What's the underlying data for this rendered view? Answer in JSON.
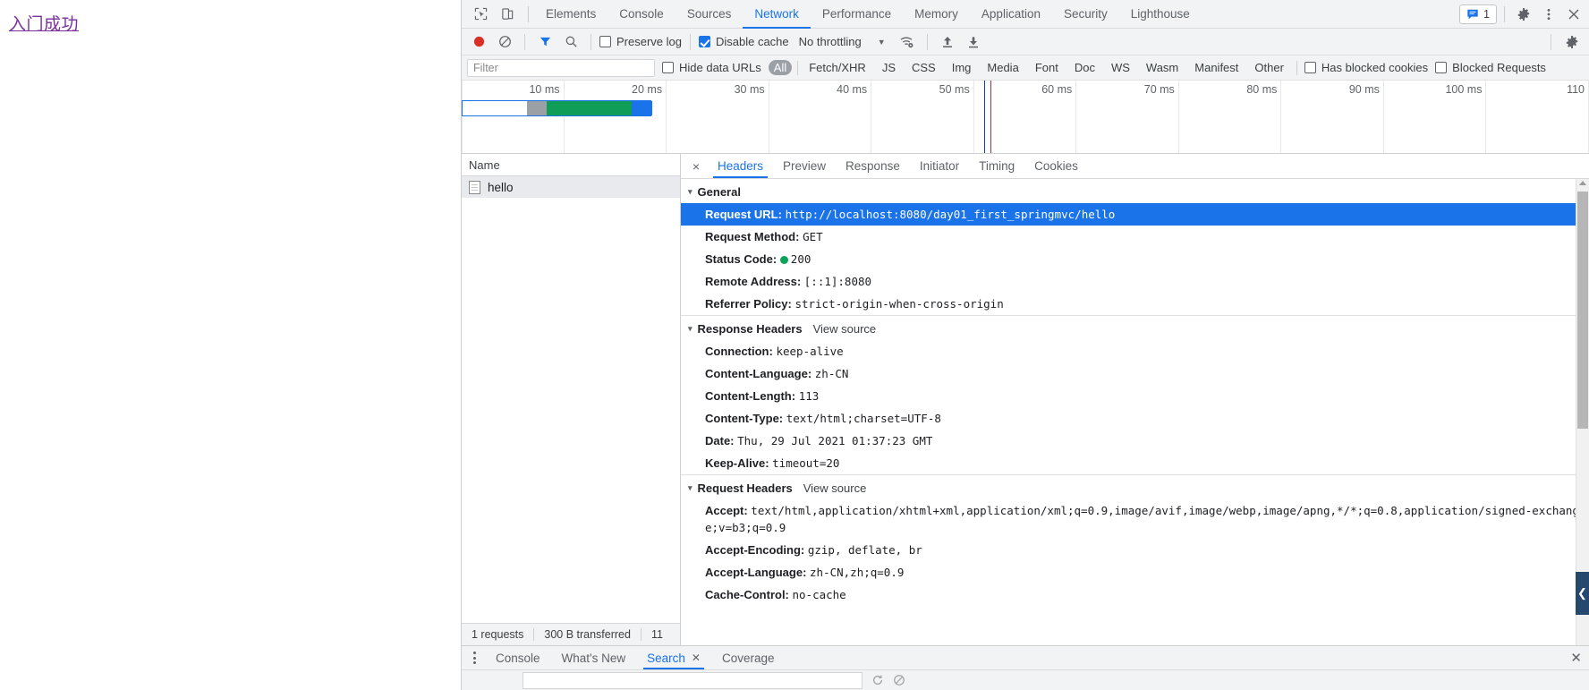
{
  "page": {
    "link_text": "入门成功"
  },
  "main_tabbar": {
    "icons": [
      {
        "name": "inspect-element-icon",
        "label": "Inspect element"
      },
      {
        "name": "device-toolbar-icon",
        "label": "Toggle device toolbar"
      }
    ],
    "tabs": [
      {
        "label": "Elements",
        "active": false
      },
      {
        "label": "Console",
        "active": false
      },
      {
        "label": "Sources",
        "active": false
      },
      {
        "label": "Network",
        "active": true
      },
      {
        "label": "Performance",
        "active": false
      },
      {
        "label": "Memory",
        "active": false
      },
      {
        "label": "Application",
        "active": false
      },
      {
        "label": "Security",
        "active": false
      },
      {
        "label": "Lighthouse",
        "active": false
      }
    ],
    "message_count": "1",
    "right_icons": [
      {
        "name": "message-badge-icon"
      },
      {
        "name": "settings-gear-icon"
      },
      {
        "name": "more-options-icon"
      },
      {
        "name": "close-devtools-icon"
      }
    ]
  },
  "network_toolbar": {
    "record_label": "Record network log",
    "clear_label": "Clear",
    "filter_icon_label": "Filter",
    "search_icon_label": "Search",
    "preserve_log": {
      "label": "Preserve log",
      "checked": false
    },
    "disable_cache": {
      "label": "Disable cache",
      "checked": true
    },
    "throttling": {
      "value": "No throttling",
      "caret": "▼"
    },
    "wifi_icon_label": "Network conditions",
    "import_label": "Import HAR file",
    "export_label": "Export HAR file",
    "settings_label": "Network settings"
  },
  "filter_row": {
    "filter_placeholder": "Filter",
    "filter_value": "",
    "hide_data_urls": {
      "label": "Hide data URLs",
      "checked": false
    },
    "types": [
      {
        "label": "All",
        "active": true
      },
      {
        "label": "Fetch/XHR",
        "active": false
      },
      {
        "label": "JS",
        "active": false
      },
      {
        "label": "CSS",
        "active": false
      },
      {
        "label": "Img",
        "active": false
      },
      {
        "label": "Media",
        "active": false
      },
      {
        "label": "Font",
        "active": false
      },
      {
        "label": "Doc",
        "active": false
      },
      {
        "label": "WS",
        "active": false
      },
      {
        "label": "Wasm",
        "active": false
      },
      {
        "label": "Manifest",
        "active": false
      },
      {
        "label": "Other",
        "active": false
      }
    ],
    "has_blocked_cookies": {
      "label": "Has blocked cookies",
      "checked": false
    },
    "blocked_requests": {
      "label": "Blocked Requests",
      "checked": false
    }
  },
  "overview": {
    "ticks": [
      "10 ms",
      "20 ms",
      "30 ms",
      "40 ms",
      "50 ms",
      "60 ms",
      "70 ms",
      "80 ms",
      "90 ms",
      "100 ms",
      "110"
    ],
    "bar": {
      "total_ms": 18.5,
      "segments": [
        {
          "name": "waiting",
          "start_ms": 0.0,
          "end_ms": 6.3,
          "color": "#ffffff"
        },
        {
          "name": "stalled",
          "start_ms": 6.3,
          "end_ms": 8.2,
          "color": "#9aa0a6"
        },
        {
          "name": "download",
          "start_ms": 8.2,
          "end_ms": 16.5,
          "color": "#0f9d58"
        },
        {
          "name": "finish",
          "start_ms": 16.5,
          "end_ms": 18.5,
          "color": "#1a73e8"
        }
      ]
    },
    "event_lines": [
      {
        "name": "dom-content-loaded",
        "ms": 51.0,
        "color": "#0d47a1"
      },
      {
        "name": "load",
        "ms": 51.6,
        "color": "#c62828"
      }
    ]
  },
  "requests_pane": {
    "column_header": "Name",
    "rows": [
      {
        "name": "hello",
        "selected": true,
        "icon": "document-icon"
      }
    ],
    "status": {
      "requests": "1 requests",
      "transferred": "300 B transferred",
      "resources": "11"
    }
  },
  "detail": {
    "tabs": [
      {
        "label": "Headers",
        "active": true
      },
      {
        "label": "Preview",
        "active": false
      },
      {
        "label": "Response",
        "active": false
      },
      {
        "label": "Initiator",
        "active": false
      },
      {
        "label": "Timing",
        "active": false
      },
      {
        "label": "Cookies",
        "active": false
      }
    ],
    "close_label": "×",
    "sections": [
      {
        "title": "General",
        "triangle": "▾",
        "view_source": null,
        "rows": [
          {
            "key": "Request URL:",
            "value": "http://localhost:8080/day01_first_springmvc/hello",
            "selected": true
          },
          {
            "key": "Request Method:",
            "value": "GET",
            "selected": false
          },
          {
            "key": "Status Code:",
            "value": "200",
            "status_dot": "#09a35a",
            "selected": false
          },
          {
            "key": "Remote Address:",
            "value": "[::1]:8080",
            "selected": false
          },
          {
            "key": "Referrer Policy:",
            "value": "strict-origin-when-cross-origin",
            "selected": false
          }
        ]
      },
      {
        "title": "Response Headers",
        "triangle": "▾",
        "view_source": "View source",
        "rows": [
          {
            "key": "Connection:",
            "value": "keep-alive",
            "selected": false
          },
          {
            "key": "Content-Language:",
            "value": "zh-CN",
            "selected": false
          },
          {
            "key": "Content-Length:",
            "value": "113",
            "selected": false
          },
          {
            "key": "Content-Type:",
            "value": "text/html;charset=UTF-8",
            "selected": false
          },
          {
            "key": "Date:",
            "value": "Thu, 29 Jul 2021 01:37:23 GMT",
            "selected": false
          },
          {
            "key": "Keep-Alive:",
            "value": "timeout=20",
            "selected": false
          }
        ]
      },
      {
        "title": "Request Headers",
        "triangle": "▾",
        "view_source": "View source",
        "rows": [
          {
            "key": "Accept:",
            "value": "text/html,application/xhtml+xml,application/xml;q=0.9,image/avif,image/webp,image/apng,*/*;q=0.8,application/signed-exchange;v=b3;q=0.9",
            "selected": false
          },
          {
            "key": "Accept-Encoding:",
            "value": "gzip, deflate, br",
            "selected": false
          },
          {
            "key": "Accept-Language:",
            "value": "zh-CN,zh;q=0.9",
            "selected": false
          },
          {
            "key": "Cache-Control:",
            "value": "no-cache",
            "selected": false
          }
        ]
      }
    ],
    "collapse_button": "❮"
  },
  "drawer": {
    "menu_icon": "more-options-icon",
    "tabs": [
      {
        "label": "Console",
        "active": false,
        "closable": false
      },
      {
        "label": "What's New",
        "active": false,
        "closable": false
      },
      {
        "label": "Search",
        "active": true,
        "closable": true,
        "close_glyph": "✕"
      },
      {
        "label": "Coverage",
        "active": false,
        "closable": false
      }
    ],
    "close_label": "✕",
    "search_input_value": "",
    "search_input_placeholder": ""
  }
}
